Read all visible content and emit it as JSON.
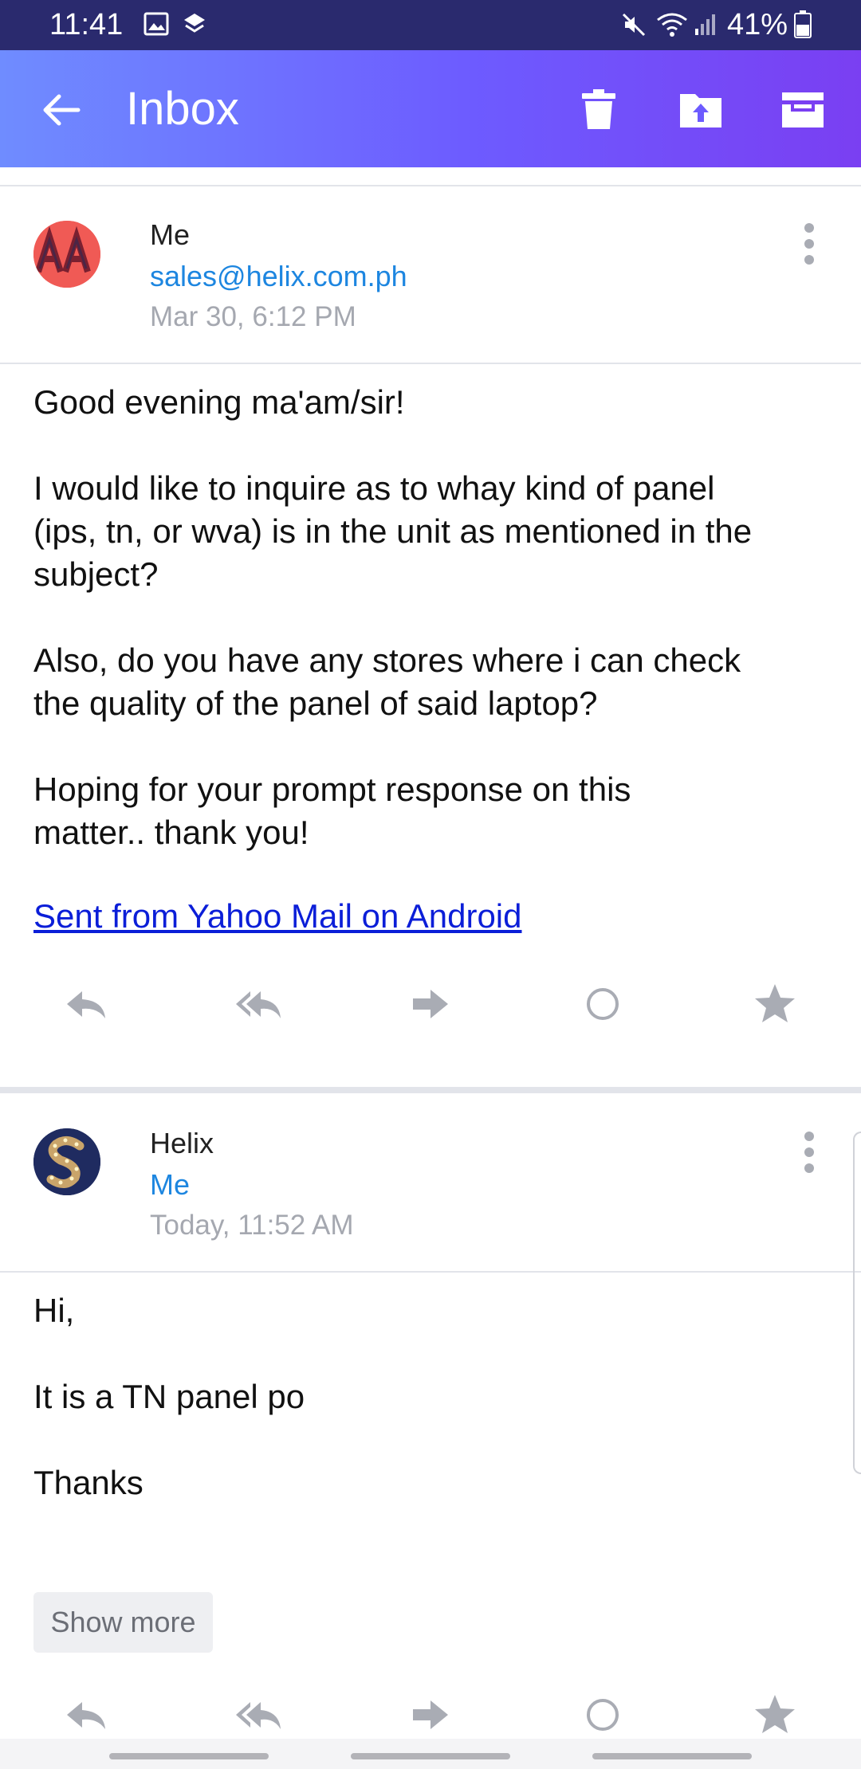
{
  "status_bar": {
    "time": "11:41",
    "battery": "41%"
  },
  "app_bar": {
    "title": "Inbox"
  },
  "messages": [
    {
      "sender": "Me",
      "recipient": "sales@helix.com.ph",
      "date": "Mar 30, 6:12 PM",
      "body": [
        "Good evening ma'am/sir!",
        "I would like to inquire as to whay kind of panel\n(ips, tn, or wva) is in the unit as mentioned in the\nsubject?",
        "Also, do you have any stores where i can check\nthe quality of the panel of said laptop?",
        "Hoping for your prompt response on this\nmatter.. thank you!"
      ],
      "signature_link": "Sent from Yahoo Mail on Android"
    },
    {
      "sender": "Helix",
      "recipient": "Me",
      "date": "Today, 11:52 AM",
      "body": [
        "Hi,",
        "It is a TN panel po",
        "Thanks"
      ],
      "show_more_label": "Show more"
    }
  ],
  "icons": [
    "back-arrow-icon",
    "trash-icon",
    "move-folder-icon",
    "archive-icon",
    "reply-icon",
    "reply-all-icon",
    "forward-icon",
    "mark-unread-icon",
    "star-icon",
    "more-vert-icon"
  ],
  "colors": {
    "app_bar_start": "#6f8cff",
    "app_bar_end": "#7a3ff2",
    "link": "#1d86e0",
    "icon_gray": "#a9acb4"
  }
}
